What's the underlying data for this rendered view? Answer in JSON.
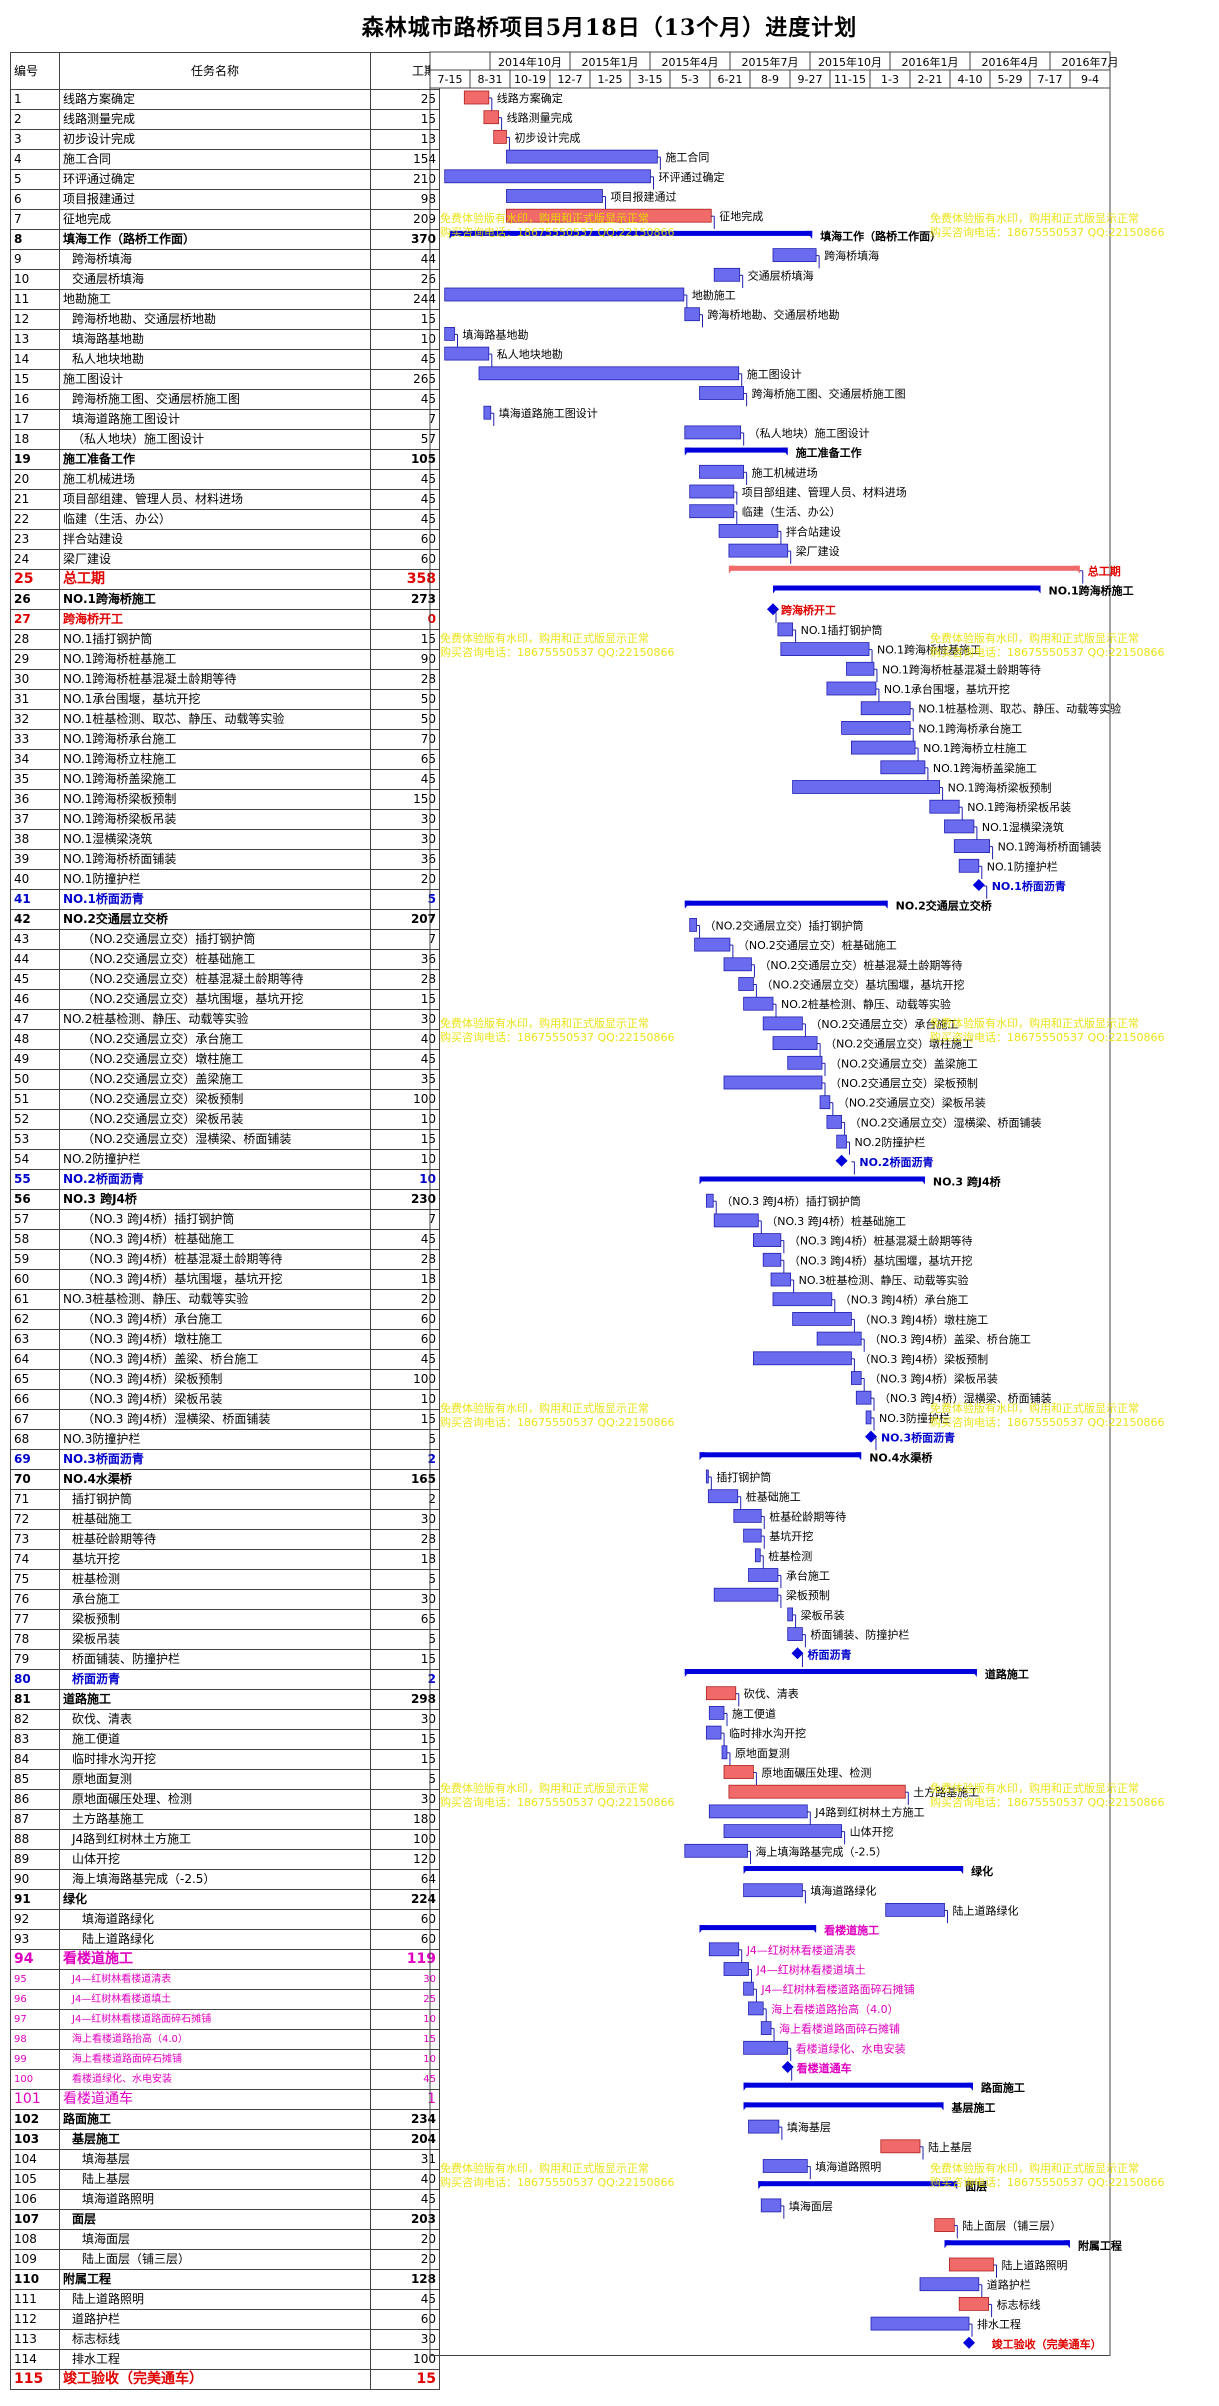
{
  "title": "森林城市路桥项目5月18日（13个月）进度计划",
  "headers": {
    "id": "编号",
    "name": "任务名称",
    "duration": "工期"
  },
  "timeline": {
    "top": [
      "2014年10月",
      "2015年1月",
      "2015年4月",
      "2015年7月",
      "2015年10月",
      "2016年1月",
      "2016年4月",
      "2016年7月"
    ],
    "bottom": [
      "7-15",
      "8-31",
      "10-19",
      "12-7",
      "1-25",
      "3-15",
      "5-3",
      "6-21",
      "8-9",
      "9-27",
      "11-15",
      "1-3",
      "2-21",
      "4-10",
      "5-29",
      "7-17",
      "9-4"
    ]
  },
  "watermark": {
    "line1": "免费体验版有水印，购用和正式版显示正常",
    "line2": "购买咨询电话：18675550537 QQ:22150866"
  },
  "colors": {
    "bar": "#6b6bf0",
    "bar_border": "#2020b0",
    "critical": "#f06a6a",
    "summary": "#0000dd",
    "red_text": "#e00000",
    "blue_text": "#0000cc",
    "pink_text": "#e000c0"
  },
  "chart_data": {
    "type": "gantt",
    "title": "森林城市路桥项目5月18日（13个月）进度计划",
    "x_ticks": [
      "7-15",
      "8-31",
      "10-19",
      "12-7",
      "1-25",
      "3-15",
      "5-3",
      "6-21",
      "8-9",
      "9-27",
      "11-15",
      "1-3",
      "2-21",
      "4-10",
      "5-29",
      "7-17",
      "9-4"
    ],
    "tasks": [
      {
        "id": "1",
        "name": "线路方案确定",
        "dur": "25",
        "s": 15,
        "e": 40,
        "c": 1
      },
      {
        "id": "2",
        "name": "线路测量完成",
        "dur": "15",
        "s": 35,
        "e": 50,
        "c": 1
      },
      {
        "id": "3",
        "name": "初步设计完成",
        "dur": "13",
        "s": 45,
        "e": 58,
        "c": 1
      },
      {
        "id": "4",
        "name": "施工合同",
        "dur": "154",
        "s": 58,
        "e": 212
      },
      {
        "id": "5",
        "name": "环评通过确定",
        "dur": "210",
        "s": -5,
        "e": 205
      },
      {
        "id": "6",
        "name": "项目报建通过",
        "dur": "98",
        "s": 58,
        "e": 156
      },
      {
        "id": "7",
        "name": "征地完成",
        "dur": "209",
        "s": 58,
        "e": 267,
        "c": 1
      },
      {
        "id": "8",
        "name": "填海工作（路桥工作面）",
        "dur": "370",
        "s": 0,
        "e": 370,
        "t": "sum"
      },
      {
        "id": "9",
        "name": "跨海桥填海",
        "dur": "44",
        "s": 330,
        "e": 374,
        "i": 1
      },
      {
        "id": "10",
        "name": "交通层桥填海",
        "dur": "26",
        "s": 270,
        "e": 296,
        "i": 1
      },
      {
        "id": "11",
        "name": "地勘施工",
        "dur": "244",
        "s": -5,
        "e": 239
      },
      {
        "id": "12",
        "name": "跨海桥地勘、交通层桥地勘",
        "dur": "15",
        "s": 240,
        "e": 255,
        "i": 1
      },
      {
        "id": "13",
        "name": "填海路基地勘",
        "dur": "10",
        "s": -5,
        "e": 5,
        "i": 1
      },
      {
        "id": "14",
        "name": "私人地块地勘",
        "dur": "45",
        "s": -5,
        "e": 40,
        "i": 1
      },
      {
        "id": "15",
        "name": "施工图设计",
        "dur": "265",
        "s": 30,
        "e": 295
      },
      {
        "id": "16",
        "name": "跨海桥施工图、交通层桥施工图",
        "dur": "45",
        "s": 255,
        "e": 300,
        "i": 1
      },
      {
        "id": "17",
        "name": "填海道路施工图设计",
        "dur": "7",
        "s": 35,
        "e": 42,
        "i": 1
      },
      {
        "id": "18",
        "name": "（私人地块）施工图设计",
        "dur": "57",
        "s": 240,
        "e": 297,
        "i": 1
      },
      {
        "id": "19",
        "name": "施工准备工作",
        "dur": "105",
        "s": 240,
        "e": 345,
        "t": "sum"
      },
      {
        "id": "20",
        "name": "施工机械进场",
        "dur": "45",
        "s": 255,
        "e": 300
      },
      {
        "id": "21",
        "name": "项目部组建、管理人员、材料进场",
        "dur": "45",
        "s": 245,
        "e": 290
      },
      {
        "id": "22",
        "name": "临建（生活、办公）",
        "dur": "45",
        "s": 245,
        "e": 290
      },
      {
        "id": "23",
        "name": "拌合站建设",
        "dur": "60",
        "s": 275,
        "e": 335
      },
      {
        "id": "24",
        "name": "梁厂建设",
        "dur": "60",
        "s": 285,
        "e": 345
      },
      {
        "id": "25",
        "name": "总工期",
        "dur": "358",
        "s": 285,
        "e": 643,
        "t": "red",
        "cls": "red big"
      },
      {
        "id": "26",
        "name": "NO.1跨海桥施工",
        "dur": "273",
        "s": 330,
        "e": 603,
        "t": "sum"
      },
      {
        "id": "27",
        "name": "跨海桥开工",
        "dur": "0",
        "s": 330,
        "e": 330,
        "t": "milestone",
        "cls": "red"
      },
      {
        "id": "28",
        "name": "NO.1插打钢护筒",
        "dur": "15",
        "s": 335,
        "e": 350
      },
      {
        "id": "29",
        "name": "NO.1跨海桥桩基施工",
        "dur": "90",
        "s": 338,
        "e": 428
      },
      {
        "id": "30",
        "name": "NO.1跨海桥桩基混凝土龄期等待",
        "dur": "28",
        "s": 405,
        "e": 433
      },
      {
        "id": "31",
        "name": "NO.1承台围堰，基坑开挖",
        "dur": "50",
        "s": 385,
        "e": 435
      },
      {
        "id": "32",
        "name": "NO.1桩基检测、取芯、静压、动载等实验",
        "dur": "50",
        "s": 420,
        "e": 470
      },
      {
        "id": "33",
        "name": "NO.1跨海桥承台施工",
        "dur": "70",
        "s": 400,
        "e": 470
      },
      {
        "id": "34",
        "name": "NO.1跨海桥立柱施工",
        "dur": "65",
        "s": 410,
        "e": 475
      },
      {
        "id": "35",
        "name": "NO.1跨海桥盖梁施工",
        "dur": "45",
        "s": 440,
        "e": 485
      },
      {
        "id": "36",
        "name": "NO.1跨海桥梁板预制",
        "dur": "150",
        "s": 350,
        "e": 500
      },
      {
        "id": "37",
        "name": "NO.1跨海桥梁板吊装",
        "dur": "30",
        "s": 490,
        "e": 520
      },
      {
        "id": "38",
        "name": "NO.1湿横梁浇筑",
        "dur": "30",
        "s": 505,
        "e": 535
      },
      {
        "id": "39",
        "name": "NO.1跨海桥桥面铺装",
        "dur": "36",
        "s": 515,
        "e": 551
      },
      {
        "id": "40",
        "name": "NO.1防撞护栏",
        "dur": "20",
        "s": 520,
        "e": 540
      },
      {
        "id": "41",
        "name": "NO.1桥面沥青",
        "dur": "5",
        "s": 540,
        "e": 545,
        "t": "milestone",
        "cls": "blue"
      },
      {
        "id": "42",
        "name": "NO.2交通层立交桥",
        "dur": "207",
        "s": 240,
        "e": 447,
        "t": "sum"
      },
      {
        "id": "43",
        "name": "（NO.2交通层立交）插打钢护筒",
        "dur": "7",
        "s": 245,
        "e": 252,
        "i": 2
      },
      {
        "id": "44",
        "name": "（NO.2交通层立交）桩基础施工",
        "dur": "36",
        "s": 250,
        "e": 286,
        "i": 2
      },
      {
        "id": "45",
        "name": "（NO.2交通层立交）桩基混凝土龄期等待",
        "dur": "28",
        "s": 280,
        "e": 308,
        "i": 2
      },
      {
        "id": "46",
        "name": "（NO.2交通层立交）基坑围堰，基坑开挖",
        "dur": "15",
        "s": 295,
        "e": 310,
        "i": 2
      },
      {
        "id": "47",
        "name": "NO.2桩基检测、静压、动载等实验",
        "dur": "30",
        "s": 300,
        "e": 330
      },
      {
        "id": "48",
        "name": "（NO.2交通层立交）承台施工",
        "dur": "40",
        "s": 320,
        "e": 360,
        "i": 2
      },
      {
        "id": "49",
        "name": "（NO.2交通层立交）墩柱施工",
        "dur": "45",
        "s": 330,
        "e": 375,
        "i": 2
      },
      {
        "id": "50",
        "name": "（NO.2交通层立交）盖梁施工",
        "dur": "35",
        "s": 345,
        "e": 380,
        "i": 2
      },
      {
        "id": "51",
        "name": "（NO.2交通层立交）梁板预制",
        "dur": "100",
        "s": 280,
        "e": 380,
        "i": 2
      },
      {
        "id": "52",
        "name": "（NO.2交通层立交）梁板吊装",
        "dur": "10",
        "s": 378,
        "e": 388,
        "i": 2
      },
      {
        "id": "53",
        "name": "（NO.2交通层立交）湿横梁、桥面铺装",
        "dur": "15",
        "s": 385,
        "e": 400,
        "i": 2
      },
      {
        "id": "54",
        "name": "NO.2防撞护栏",
        "dur": "10",
        "s": 395,
        "e": 405
      },
      {
        "id": "55",
        "name": "NO.2桥面沥青",
        "dur": "10",
        "s": 400,
        "e": 410,
        "t": "milestone",
        "cls": "blue"
      },
      {
        "id": "56",
        "name": "NO.3 跨J4桥",
        "dur": "230",
        "s": 255,
        "e": 485,
        "t": "sum"
      },
      {
        "id": "57",
        "name": "（NO.3 跨J4桥）插打钢护筒",
        "dur": "7",
        "s": 262,
        "e": 269,
        "i": 2
      },
      {
        "id": "58",
        "name": "（NO.3 跨J4桥）桩基础施工",
        "dur": "45",
        "s": 270,
        "e": 315,
        "i": 2
      },
      {
        "id": "59",
        "name": "（NO.3 跨J4桥）桩基混凝土龄期等待",
        "dur": "28",
        "s": 310,
        "e": 338,
        "i": 2
      },
      {
        "id": "60",
        "name": "（NO.3 跨J4桥）基坑围堰，基坑开挖",
        "dur": "18",
        "s": 320,
        "e": 338,
        "i": 2
      },
      {
        "id": "61",
        "name": "NO.3桩基检测、静压、动载等实验",
        "dur": "20",
        "s": 328,
        "e": 348
      },
      {
        "id": "62",
        "name": "（NO.3 跨J4桥）承台施工",
        "dur": "60",
        "s": 330,
        "e": 390,
        "i": 2
      },
      {
        "id": "63",
        "name": "（NO.3 跨J4桥）墩柱施工",
        "dur": "60",
        "s": 350,
        "e": 410,
        "i": 2
      },
      {
        "id": "64",
        "name": "（NO.3 跨J4桥）盖梁、桥台施工",
        "dur": "45",
        "s": 375,
        "e": 420,
        "i": 2
      },
      {
        "id": "65",
        "name": "（NO.3 跨J4桥）梁板预制",
        "dur": "100",
        "s": 310,
        "e": 410,
        "i": 2
      },
      {
        "id": "66",
        "name": "（NO.3 跨J4桥）梁板吊装",
        "dur": "10",
        "s": 410,
        "e": 420,
        "i": 2
      },
      {
        "id": "67",
        "name": "（NO.3 跨J4桥）湿横梁、桥面铺装",
        "dur": "15",
        "s": 415,
        "e": 430,
        "i": 2
      },
      {
        "id": "68",
        "name": "NO.3防撞护栏",
        "dur": "5",
        "s": 425,
        "e": 430
      },
      {
        "id": "69",
        "name": "NO.3桥面沥青",
        "dur": "2",
        "s": 430,
        "e": 432,
        "t": "milestone",
        "cls": "blue"
      },
      {
        "id": "70",
        "name": "NO.4水渠桥",
        "dur": "165",
        "s": 255,
        "e": 420,
        "t": "sum"
      },
      {
        "id": "71",
        "name": "插打钢护筒",
        "dur": "2",
        "s": 262,
        "e": 264,
        "i": 1
      },
      {
        "id": "72",
        "name": "桩基础施工",
        "dur": "30",
        "s": 264,
        "e": 294,
        "i": 1
      },
      {
        "id": "73",
        "name": "桩基砼龄期等待",
        "dur": "28",
        "s": 290,
        "e": 318,
        "i": 1
      },
      {
        "id": "74",
        "name": "基坑开挖",
        "dur": "18",
        "s": 300,
        "e": 318,
        "i": 1
      },
      {
        "id": "75",
        "name": "桩基检测",
        "dur": "5",
        "s": 312,
        "e": 317,
        "i": 1
      },
      {
        "id": "76",
        "name": "承台施工",
        "dur": "30",
        "s": 305,
        "e": 335,
        "i": 1
      },
      {
        "id": "77",
        "name": "梁板预制",
        "dur": "65",
        "s": 270,
        "e": 335,
        "i": 1
      },
      {
        "id": "78",
        "name": "梁板吊装",
        "dur": "5",
        "s": 345,
        "e": 350,
        "i": 1
      },
      {
        "id": "79",
        "name": "桥面铺装、防撞护栏",
        "dur": "15",
        "s": 345,
        "e": 360,
        "i": 1
      },
      {
        "id": "80",
        "name": "桥面沥青",
        "dur": "2",
        "s": 355,
        "e": 357,
        "t": "milestone",
        "cls": "blue",
        "i": 1
      },
      {
        "id": "81",
        "name": "道路施工",
        "dur": "298",
        "s": 240,
        "e": 538,
        "t": "sum"
      },
      {
        "id": "82",
        "name": "砍伐、清表",
        "dur": "30",
        "s": 262,
        "e": 292,
        "c": 1,
        "i": 1
      },
      {
        "id": "83",
        "name": "施工便道",
        "dur": "15",
        "s": 265,
        "e": 280,
        "i": 1
      },
      {
        "id": "84",
        "name": "临时排水沟开挖",
        "dur": "15",
        "s": 262,
        "e": 277,
        "i": 1
      },
      {
        "id": "85",
        "name": "原地面复测",
        "dur": "5",
        "s": 278,
        "e": 283,
        "i": 1
      },
      {
        "id": "86",
        "name": "原地面碾压处理、检测",
        "dur": "30",
        "s": 280,
        "e": 310,
        "c": 1,
        "i": 1
      },
      {
        "id": "87",
        "name": "土方路基施工",
        "dur": "180",
        "s": 285,
        "e": 465,
        "c": 1,
        "i": 1
      },
      {
        "id": "88",
        "name": "J4路到红树林土方施工",
        "dur": "100",
        "s": 265,
        "e": 365,
        "i": 1
      },
      {
        "id": "89",
        "name": "山体开挖",
        "dur": "120",
        "s": 280,
        "e": 400,
        "i": 1
      },
      {
        "id": "90",
        "name": "海上填海路基完成（-2.5）",
        "dur": "64",
        "s": 240,
        "e": 304,
        "i": 1
      },
      {
        "id": "91",
        "name": "绿化",
        "dur": "224",
        "s": 300,
        "e": 524,
        "t": "sum"
      },
      {
        "id": "92",
        "name": "填海道路绿化",
        "dur": "60",
        "s": 300,
        "e": 360,
        "i": 2
      },
      {
        "id": "93",
        "name": "陆上道路绿化",
        "dur": "60",
        "s": 445,
        "e": 505,
        "i": 2
      },
      {
        "id": "94",
        "name": "看楼道施工",
        "dur": "119",
        "s": 255,
        "e": 374,
        "t": "sum",
        "cls": "pink big"
      },
      {
        "id": "95",
        "name": "J4—红树林看楼道清表",
        "dur": "30",
        "s": 265,
        "e": 295,
        "cls": "pink",
        "i": 1
      },
      {
        "id": "96",
        "name": "J4—红树林看楼道填土",
        "dur": "25",
        "s": 280,
        "e": 305,
        "cls": "pink",
        "i": 1
      },
      {
        "id": "97",
        "name": "J4—红树林看楼道路面碎石摊铺",
        "dur": "10",
        "s": 300,
        "e": 310,
        "cls": "pink",
        "i": 1
      },
      {
        "id": "98",
        "name": "海上看楼道路抬高（4.0）",
        "dur": "15",
        "s": 305,
        "e": 320,
        "cls": "pink",
        "i": 1
      },
      {
        "id": "99",
        "name": "海上看楼道路面碎石摊铺",
        "dur": "10",
        "s": 318,
        "e": 328,
        "cls": "pink",
        "i": 1
      },
      {
        "id": "100",
        "name": "看楼道绿化、水电安装",
        "dur": "45",
        "s": 300,
        "e": 345,
        "cls": "pink",
        "i": 1
      },
      {
        "id": "101",
        "name": "看楼道通车",
        "dur": "1",
        "s": 345,
        "e": 346,
        "t": "milestone",
        "cls": "pink big"
      },
      {
        "id": "102",
        "name": "路面施工",
        "dur": "234",
        "s": 300,
        "e": 534,
        "t": "sum"
      },
      {
        "id": "103",
        "name": "基层施工",
        "dur": "204",
        "s": 300,
        "e": 504,
        "t": "sum",
        "i": 1
      },
      {
        "id": "104",
        "name": "填海基层",
        "dur": "31",
        "s": 305,
        "e": 336,
        "i": 2
      },
      {
        "id": "105",
        "name": "陆上基层",
        "dur": "40",
        "s": 440,
        "e": 480,
        "c": 1,
        "i": 2
      },
      {
        "id": "106",
        "name": "填海道路照明",
        "dur": "45",
        "s": 320,
        "e": 365,
        "i": 2
      },
      {
        "id": "107",
        "name": "面层",
        "dur": "203",
        "s": 315,
        "e": 518,
        "t": "sum",
        "i": 1
      },
      {
        "id": "108",
        "name": "填海面层",
        "dur": "20",
        "s": 318,
        "e": 338,
        "i": 2
      },
      {
        "id": "109",
        "name": "陆上面层（铺三层）",
        "dur": "20",
        "s": 495,
        "e": 515,
        "c": 1,
        "i": 2
      },
      {
        "id": "110",
        "name": "附属工程",
        "dur": "128",
        "s": 505,
        "e": 633,
        "t": "sum"
      },
      {
        "id": "111",
        "name": "陆上道路照明",
        "dur": "45",
        "s": 510,
        "e": 555,
        "c": 1,
        "i": 1
      },
      {
        "id": "112",
        "name": "道路护栏",
        "dur": "60",
        "s": 480,
        "e": 540,
        "i": 1
      },
      {
        "id": "113",
        "name": "标志标线",
        "dur": "30",
        "s": 520,
        "e": 550,
        "c": 1,
        "i": 1
      },
      {
        "id": "114",
        "name": "排水工程",
        "dur": "100",
        "s": 430,
        "e": 530,
        "i": 1
      },
      {
        "id": "115",
        "name": "竣工验收（完美通车）",
        "dur": "15",
        "s": 530,
        "e": 545,
        "t": "milestone",
        "cls": "red big"
      }
    ]
  }
}
